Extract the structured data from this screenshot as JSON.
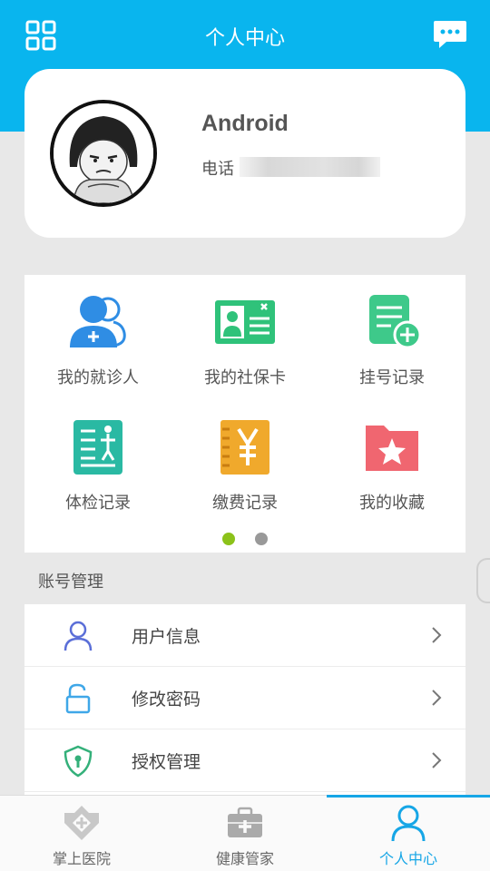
{
  "header": {
    "title": "个人中心",
    "menu_icon": "grid-icon",
    "message_icon": "chat-icon"
  },
  "profile": {
    "name": "Android",
    "phone_label": "电话"
  },
  "services": [
    {
      "label": "我的就诊人",
      "icon": "patient-icon",
      "color": "#2f8de4"
    },
    {
      "label": "我的社保卡",
      "icon": "id-card-icon",
      "color": "#2fc27a"
    },
    {
      "label": "挂号记录",
      "icon": "register-record-icon",
      "color": "#3ec98a"
    },
    {
      "label": "体检记录",
      "icon": "checkup-icon",
      "color": "#2ab9a3"
    },
    {
      "label": "缴费记录",
      "icon": "payment-icon",
      "color": "#f0a92c"
    },
    {
      "label": "我的收藏",
      "icon": "favorites-icon",
      "color": "#f06670"
    }
  ],
  "pager": {
    "pages": 2,
    "active": 1,
    "active_color": "#8cc21a",
    "inactive_color": "#999999"
  },
  "account": {
    "section_title": "账号管理",
    "items": [
      {
        "label": "用户信息",
        "icon": "user-icon"
      },
      {
        "label": "修改密码",
        "icon": "lock-icon"
      },
      {
        "label": "授权管理",
        "icon": "shield-icon"
      }
    ]
  },
  "nav": {
    "items": [
      {
        "label": "掌上医院",
        "icon": "hospital-icon"
      },
      {
        "label": "健康管家",
        "icon": "medkit-icon"
      },
      {
        "label": "个人中心",
        "icon": "person-icon",
        "active": true
      }
    ],
    "accent": "#16a6e6"
  },
  "colors": {
    "header_bg": "#09b5ee",
    "page_bg": "#e8e8e8"
  }
}
